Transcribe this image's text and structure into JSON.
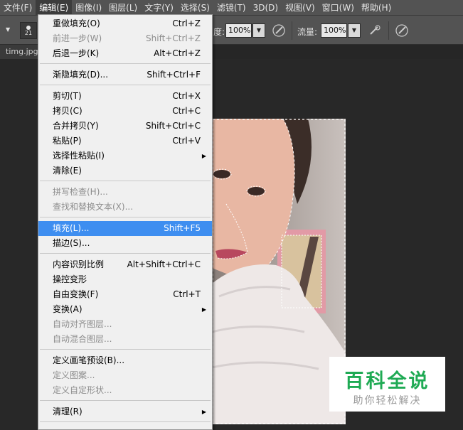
{
  "menubar": {
    "items": [
      "文件(F)",
      "编辑(E)",
      "图像(I)",
      "图层(L)",
      "文字(Y)",
      "选择(S)",
      "滤镜(T)",
      "3D(D)",
      "视图(V)",
      "窗口(W)",
      "帮助(H)"
    ],
    "active_index": 1
  },
  "options": {
    "brush_size": "21",
    "opacity_label": "度:",
    "opacity_value": "100%",
    "flow_label": "流量:",
    "flow_value": "100%"
  },
  "document": {
    "tab_name": "timg.jpg"
  },
  "edit_menu": {
    "items": [
      {
        "label": "重做填充(O)",
        "shortcut": "Ctrl+Z",
        "enabled": true
      },
      {
        "label": "前进一步(W)",
        "shortcut": "Shift+Ctrl+Z",
        "enabled": false
      },
      {
        "label": "后退一步(K)",
        "shortcut": "Alt+Ctrl+Z",
        "enabled": true
      },
      {
        "label": "渐隐填充(D)...",
        "shortcut": "Shift+Ctrl+F",
        "enabled": true
      },
      {
        "label": "剪切(T)",
        "shortcut": "Ctrl+X",
        "enabled": true
      },
      {
        "label": "拷贝(C)",
        "shortcut": "Ctrl+C",
        "enabled": true
      },
      {
        "label": "合并拷贝(Y)",
        "shortcut": "Shift+Ctrl+C",
        "enabled": true
      },
      {
        "label": "粘贴(P)",
        "shortcut": "Ctrl+V",
        "enabled": true
      },
      {
        "label": "选择性粘贴(I)",
        "shortcut": "",
        "enabled": true,
        "submenu": true
      },
      {
        "label": "清除(E)",
        "shortcut": "",
        "enabled": true
      },
      {
        "label": "拼写检查(H)...",
        "shortcut": "",
        "enabled": false
      },
      {
        "label": "查找和替换文本(X)...",
        "shortcut": "",
        "enabled": false
      },
      {
        "label": "填充(L)...",
        "shortcut": "Shift+F5",
        "enabled": true,
        "highlighted": true
      },
      {
        "label": "描边(S)...",
        "shortcut": "",
        "enabled": true
      },
      {
        "label": "内容识别比例",
        "shortcut": "Alt+Shift+Ctrl+C",
        "enabled": true
      },
      {
        "label": "操控变形",
        "shortcut": "",
        "enabled": true
      },
      {
        "label": "自由变换(F)",
        "shortcut": "Ctrl+T",
        "enabled": true
      },
      {
        "label": "变换(A)",
        "shortcut": "",
        "enabled": true,
        "submenu": true
      },
      {
        "label": "自动对齐图层...",
        "shortcut": "",
        "enabled": false
      },
      {
        "label": "自动混合图层...",
        "shortcut": "",
        "enabled": false
      },
      {
        "label": "定义画笔预设(B)...",
        "shortcut": "",
        "enabled": true
      },
      {
        "label": "定义图案...",
        "shortcut": "",
        "enabled": false
      },
      {
        "label": "定义自定形状...",
        "shortcut": "",
        "enabled": false
      },
      {
        "label": "清理(R)",
        "shortcut": "",
        "enabled": true,
        "submenu": true
      }
    ]
  },
  "watermark": {
    "title": "百科全说",
    "subtitle": "助你轻松解决"
  }
}
